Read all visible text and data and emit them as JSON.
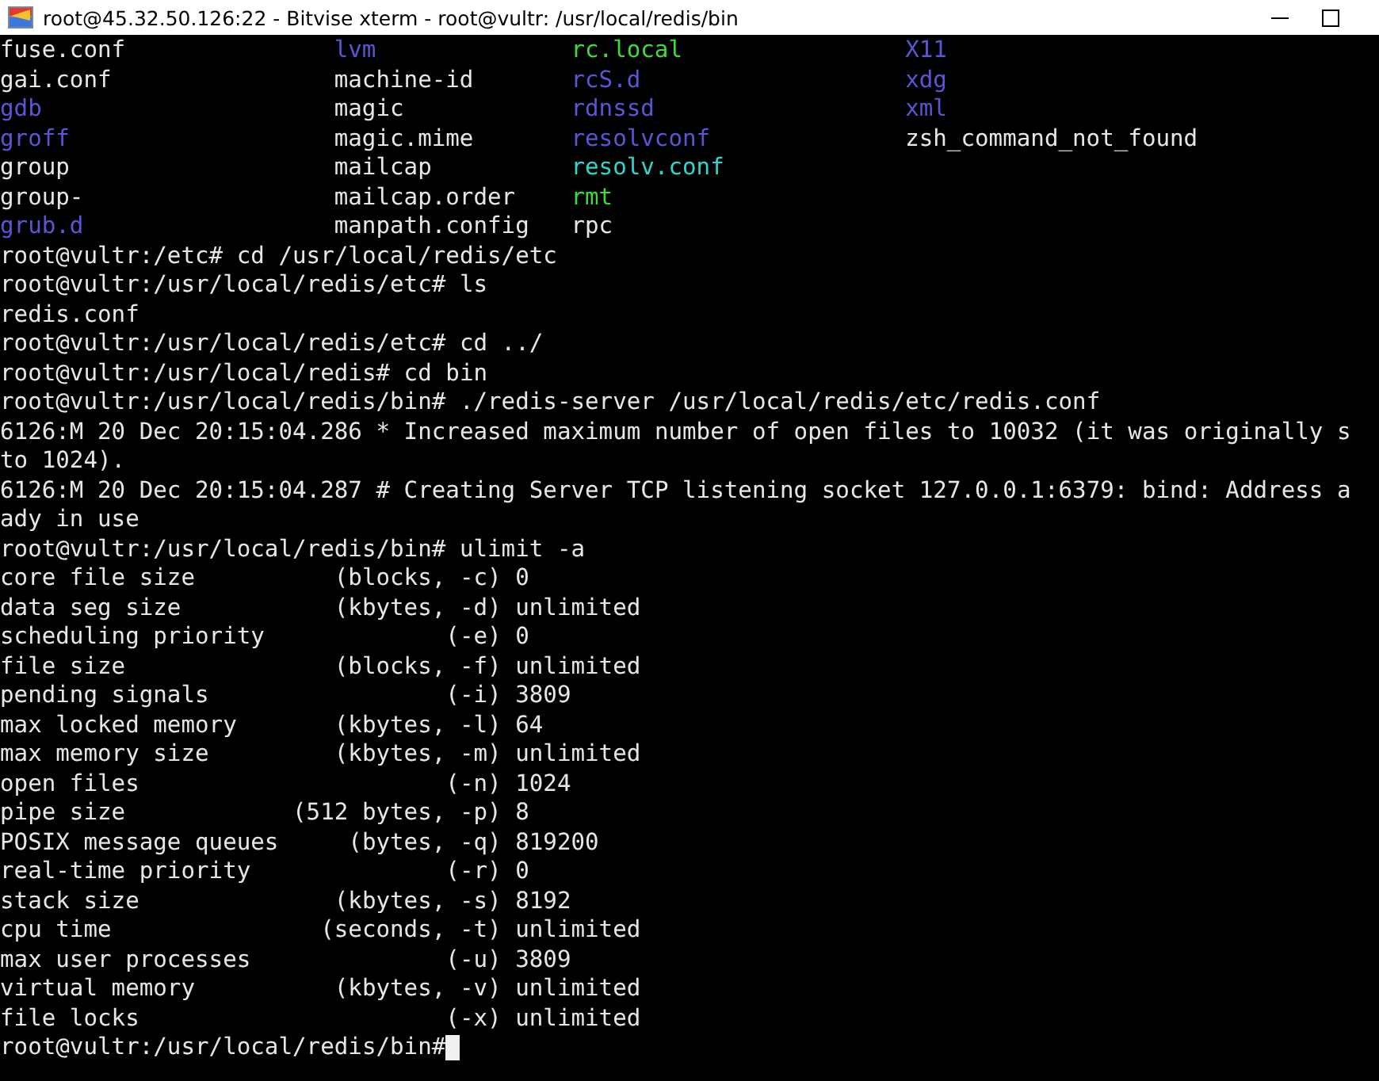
{
  "window": {
    "title": "root@45.32.50.126:22 - Bitvise xterm - root@vultr: /usr/local/redis/bin"
  },
  "ls_listing": [
    [
      {
        "text": "fuse.conf",
        "color": "#e6e6e6"
      },
      {
        "text": "lvm",
        "color": "#5b55d6"
      },
      {
        "text": "rc.local",
        "color": "#3ddc3d"
      },
      {
        "text": "X11",
        "color": "#5b55d6"
      }
    ],
    [
      {
        "text": "gai.conf",
        "color": "#e6e6e6"
      },
      {
        "text": "machine-id",
        "color": "#e6e6e6"
      },
      {
        "text": "rcS.d",
        "color": "#5b55d6"
      },
      {
        "text": "xdg",
        "color": "#5b55d6"
      }
    ],
    [
      {
        "text": "gdb",
        "color": "#5b55d6"
      },
      {
        "text": "magic",
        "color": "#e6e6e6"
      },
      {
        "text": "rdnssd",
        "color": "#5b55d6"
      },
      {
        "text": "xml",
        "color": "#5b55d6"
      }
    ],
    [
      {
        "text": "groff",
        "color": "#5b55d6"
      },
      {
        "text": "magic.mime",
        "color": "#e6e6e6"
      },
      {
        "text": "resolvconf",
        "color": "#5b55d6"
      },
      {
        "text": "zsh_command_not_found",
        "color": "#e6e6e6"
      }
    ],
    [
      {
        "text": "group",
        "color": "#e6e6e6"
      },
      {
        "text": "mailcap",
        "color": "#e6e6e6"
      },
      {
        "text": "resolv.conf",
        "color": "#2fd6cc"
      }
    ],
    [
      {
        "text": "group-",
        "color": "#e6e6e6"
      },
      {
        "text": "mailcap.order",
        "color": "#e6e6e6"
      },
      {
        "text": "rmt",
        "color": "#3ddc3d"
      }
    ],
    [
      {
        "text": "grub.d",
        "color": "#5b55d6"
      },
      {
        "text": "manpath.config",
        "color": "#e6e6e6"
      },
      {
        "text": "rpc",
        "color": "#e6e6e6"
      }
    ]
  ],
  "output_lines": [
    "root@vultr:/etc# cd /usr/local/redis/etc",
    "root@vultr:/usr/local/redis/etc# ls",
    "redis.conf",
    "root@vultr:/usr/local/redis/etc# cd ../",
    "root@vultr:/usr/local/redis# cd bin",
    "root@vultr:/usr/local/redis/bin# ./redis-server /usr/local/redis/etc/redis.conf",
    "6126:M 20 Dec 20:15:04.286 * Increased maximum number of open files to 10032 (it was originally s",
    "to 1024).",
    "6126:M 20 Dec 20:15:04.287 # Creating Server TCP listening socket 127.0.0.1:6379: bind: Address a",
    "ady in use",
    "root@vultr:/usr/local/redis/bin# ulimit -a",
    "core file size          (blocks, -c) 0",
    "data seg size           (kbytes, -d) unlimited",
    "scheduling priority             (-e) 0",
    "file size               (blocks, -f) unlimited",
    "pending signals                 (-i) 3809",
    "max locked memory       (kbytes, -l) 64",
    "max memory size         (kbytes, -m) unlimited",
    "open files                      (-n) 1024",
    "pipe size            (512 bytes, -p) 8",
    "POSIX message queues     (bytes, -q) 819200",
    "real-time priority              (-r) 0",
    "stack size              (kbytes, -s) 8192",
    "cpu time               (seconds, -t) unlimited",
    "max user processes              (-u) 3809",
    "virtual memory          (kbytes, -v) unlimited",
    "file locks                      (-x) unlimited"
  ],
  "prompt": "root@vultr:/usr/local/redis/bin#"
}
